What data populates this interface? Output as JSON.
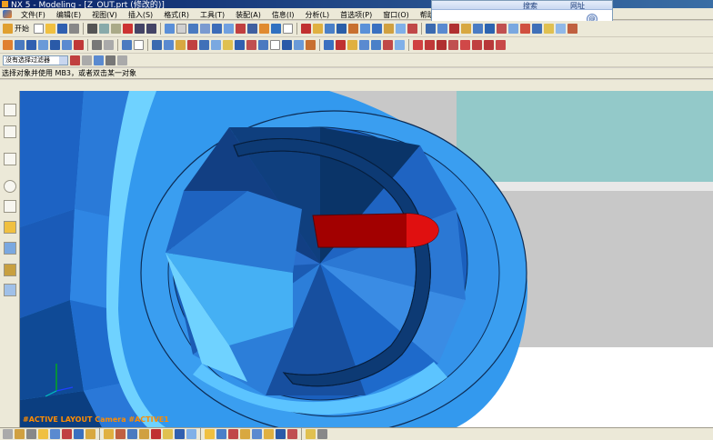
{
  "window": {
    "title": "NX 5 - Modeling - [Z_OUT.prt (修改的)]"
  },
  "menu": {
    "items": [
      "文件(F)",
      "编辑(E)",
      "视图(V)",
      "插入(S)",
      "格式(R)",
      "工具(T)",
      "装配(A)",
      "信息(I)",
      "分析(L)",
      "首选项(P)",
      "窗口(O)",
      "帮助(H)"
    ]
  },
  "search_panel": {
    "search_label": "搜索",
    "web_label": "网址",
    "go_label": "@"
  },
  "toolbar": {
    "start_label": "开始"
  },
  "selection": {
    "filter_value": "没有选择过滤器"
  },
  "status": {
    "prompt": "选择对象并使用 MB3，或者双击某一对象"
  },
  "viewport": {
    "label": "#ACTIVE LAYOUT Camera #ACTIVE1"
  },
  "colors": {
    "part_blue": "#3399ee",
    "part_dark": "#0a3d73",
    "part_light": "#6fd2ff",
    "red_part": "#a20000",
    "background_teal": "#93c9c9",
    "background_gray": "#c8c8c8",
    "label_orange": "#ff8c00"
  },
  "icons": {
    "left_toolbar": [
      "sketch-icon",
      "curve-icon",
      "assembly-icon",
      "measure-icon",
      "info-icon",
      "palette-icon",
      "dimension-icon",
      "history-icon",
      "view-icon"
    ]
  }
}
